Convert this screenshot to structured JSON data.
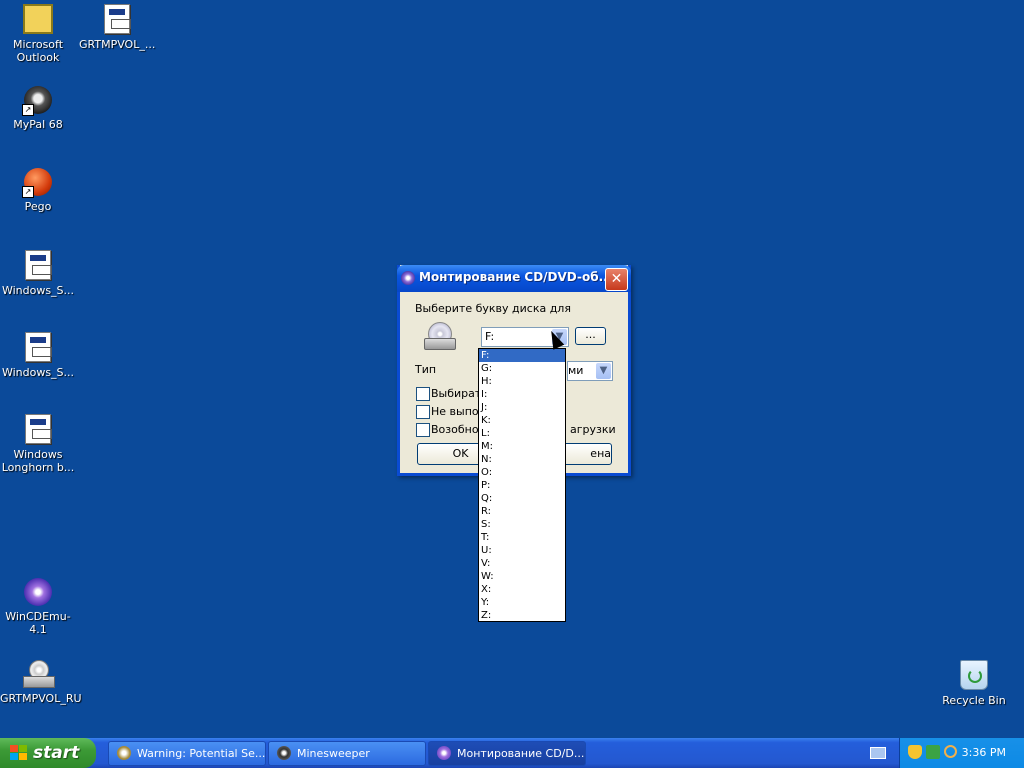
{
  "desktop": {
    "icons": [
      {
        "label": "Microsoft Outlook"
      },
      {
        "label": "GRTMPVOL_..."
      },
      {
        "label": "MyPal 68"
      },
      {
        "label": "Pego"
      },
      {
        "label": "Windows_S..."
      },
      {
        "label": "Windows_S..."
      },
      {
        "label": "Windows Longhorn b..."
      },
      {
        "label": "WinCDEmu-4.1"
      },
      {
        "label": "GRTMPVOL_RU"
      },
      {
        "label": "Recycle Bin"
      }
    ]
  },
  "dialog": {
    "title": "Монтирование CD/DVD-об...",
    "close": "✕",
    "select_label": "Выберите букву диска для",
    "drive_value": "F:",
    "browse_label": "...",
    "type_label": "Тип",
    "type_value": "ми",
    "check1": "Выбирать",
    "check2": "Не выпол",
    "check3": "Возобнов",
    "check3_tail": "агрузки",
    "ok_label": "OK",
    "cancel_label": "ена",
    "drive_options": [
      "F:",
      "G:",
      "H:",
      "I:",
      "J:",
      "K:",
      "L:",
      "M:",
      "N:",
      "O:",
      "P:",
      "Q:",
      "R:",
      "S:",
      "T:",
      "U:",
      "V:",
      "W:",
      "X:",
      "Y:",
      "Z:"
    ]
  },
  "taskbar": {
    "start_label": "start",
    "tasks": [
      {
        "label": "Warning: Potential Se..."
      },
      {
        "label": "Minesweeper"
      },
      {
        "label": "Монтирование CD/D..."
      }
    ],
    "clock": "3:36 PM"
  }
}
